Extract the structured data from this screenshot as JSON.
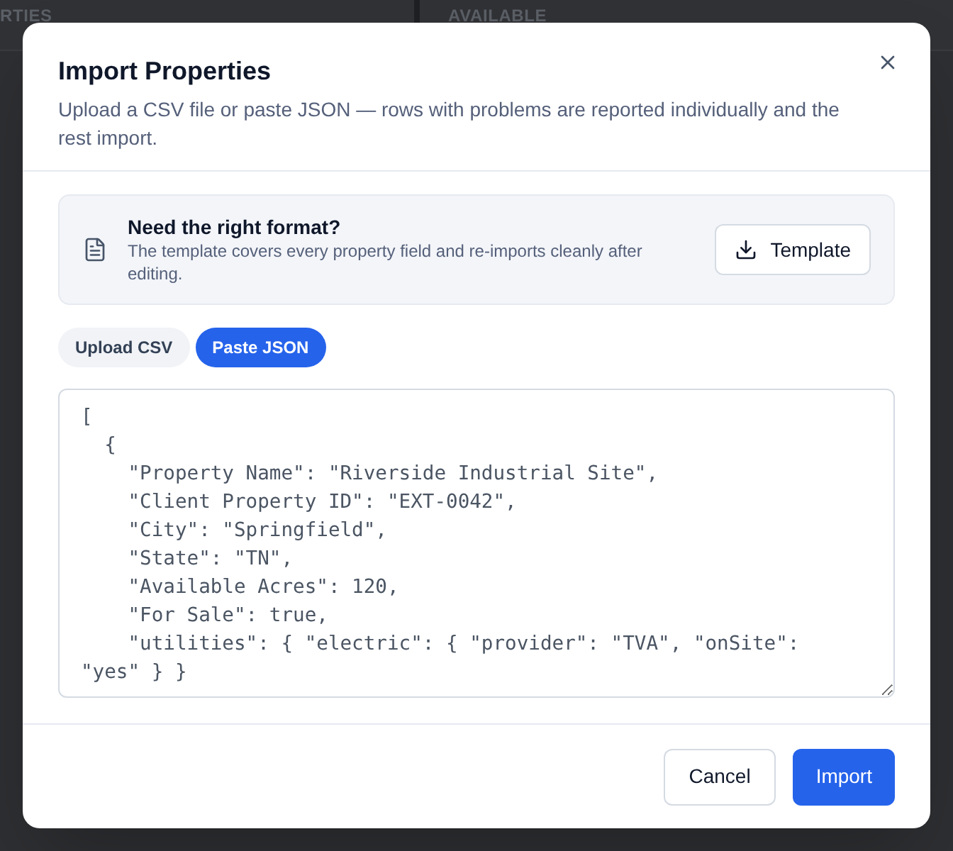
{
  "background": {
    "columns": [
      "RTIES",
      "AVAILABLE"
    ]
  },
  "dialog": {
    "title": "Import Properties",
    "description": "Upload a CSV file or paste JSON — rows with problems are reported individually and the rest import.",
    "notice": {
      "title": "Need the right format?",
      "text": "The template covers every property field and re-imports cleanly after editing.",
      "button": "Template"
    },
    "tabs": [
      {
        "label": "Upload CSV",
        "selected": false
      },
      {
        "label": "Paste JSON",
        "selected": true
      }
    ],
    "json_input": {
      "value": "[\n  {\n    \"Property Name\": \"Riverside Industrial Site\",\n    \"Client Property ID\": \"EXT-0042\",\n    \"City\": \"Springfield\",\n    \"State\": \"TN\",\n    \"Available Acres\": 120,\n    \"For Sale\": true,\n    \"utilities\": { \"electric\": { \"provider\": \"TVA\", \"onSite\": \"yes\" } }"
    },
    "buttons": [
      {
        "label": "Cancel",
        "kind": "secondary"
      },
      {
        "label": "Import",
        "kind": "primary"
      }
    ]
  }
}
